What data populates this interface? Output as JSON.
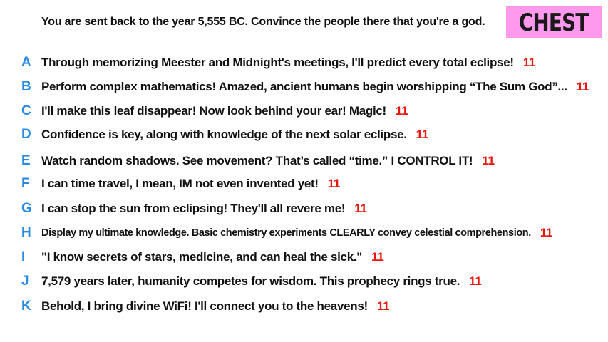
{
  "prompt": "You are sent back to the year 5,555 BC. Convince the people there that you're a god.",
  "badge": {
    "label": "CHEST",
    "color": "#ff99ee"
  },
  "colors": {
    "letter": "#2a8be6",
    "score": "#e8150f"
  },
  "answers": [
    {
      "letter": "A",
      "text": "Through memorizing Meester and Midnight's meetings, I'll predict every total eclipse!",
      "score": "11"
    },
    {
      "letter": "B",
      "text": "Perform complex mathematics! Amazed, ancient humans begin worshipping “The Sum God”...",
      "score": "11"
    },
    {
      "letter": "C",
      "text": "I'll make this leaf disappear! Now look behind your ear! Magic!",
      "score": "11"
    },
    {
      "letter": "D",
      "text": "Confidence is key, along with knowledge of the next solar eclipse.",
      "score": "11"
    },
    {
      "letter": "E",
      "text": "Watch random shadows. See movement? That’s called “time.” I CONTROL IT!",
      "score": "11"
    },
    {
      "letter": "F",
      "text": "I can time travel, I mean, IM not even invented yet!",
      "score": "11"
    },
    {
      "letter": "G",
      "text": "I can stop the sun from eclipsing! They'll all revere me!",
      "score": "11"
    },
    {
      "letter": "H",
      "text": "Display my ultimate knowledge. Basic chemistry experiments CLEARLY convey celestial comprehension.",
      "score": "11"
    },
    {
      "letter": "I",
      "text": "\"I know secrets of stars, medicine, and can heal the sick.\"",
      "score": "11"
    },
    {
      "letter": "J",
      "text": "7,579 years later, humanity competes for wisdom. This prophecy rings true.",
      "score": "11"
    },
    {
      "letter": "K",
      "text": "Behold, I bring divine WiFi! I'll connect you to the heavens!",
      "score": "11"
    }
  ]
}
